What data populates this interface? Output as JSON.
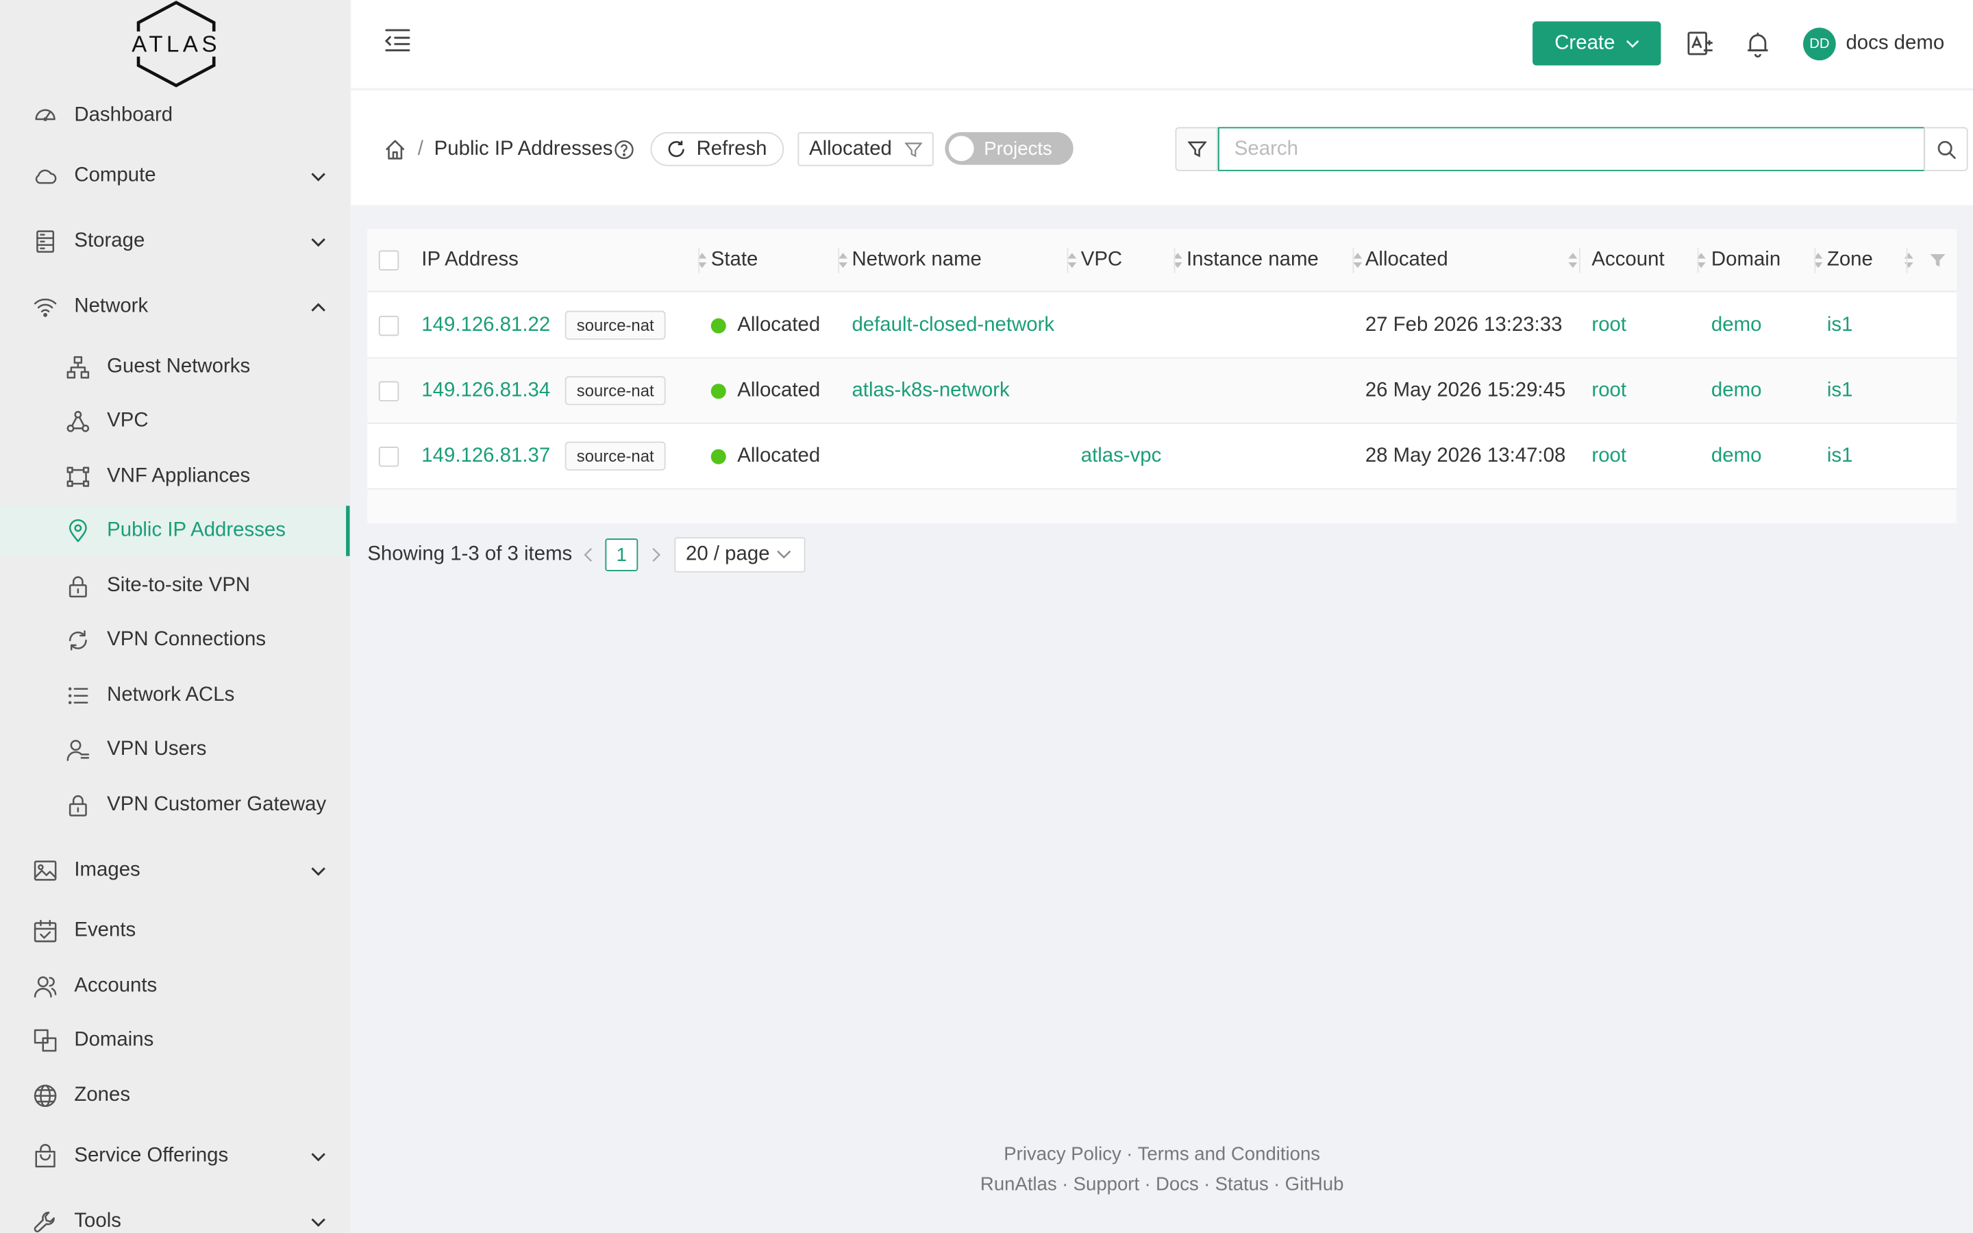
{
  "app": {
    "logo_text": "ATLAS"
  },
  "sidebar": {
    "items": [
      {
        "label": "Dashboard",
        "icon": "dashboard-icon"
      },
      {
        "label": "Compute",
        "icon": "cloud-icon"
      },
      {
        "label": "Storage",
        "icon": "storage-icon"
      },
      {
        "label": "Network",
        "icon": "wifi-icon"
      },
      {
        "label": "Guest Networks",
        "icon": "sitemap-icon"
      },
      {
        "label": "VPC",
        "icon": "vpc-icon"
      },
      {
        "label": "VNF Appliances",
        "icon": "vnf-icon"
      },
      {
        "label": "Public IP Addresses",
        "icon": "location-icon"
      },
      {
        "label": "Site-to-site VPN",
        "icon": "lock-icon"
      },
      {
        "label": "VPN Connections",
        "icon": "sync-icon"
      },
      {
        "label": "Network ACLs",
        "icon": "list-icon"
      },
      {
        "label": "VPN Users",
        "icon": "user-icon"
      },
      {
        "label": "VPN Customer Gateway",
        "icon": "lock-icon"
      },
      {
        "label": "Images",
        "icon": "image-icon"
      },
      {
        "label": "Events",
        "icon": "calendar-icon"
      },
      {
        "label": "Accounts",
        "icon": "team-icon"
      },
      {
        "label": "Domains",
        "icon": "block-icon"
      },
      {
        "label": "Zones",
        "icon": "globe-icon"
      },
      {
        "label": "Service Offerings",
        "icon": "shopping-icon"
      },
      {
        "label": "Tools",
        "icon": "tool-icon"
      }
    ]
  },
  "header": {
    "create_label": "Create",
    "user_initials": "DD",
    "user_name": "docs demo"
  },
  "toolbar": {
    "breadcrumb_title": "Public IP Addresses",
    "breadcrumb_sep": "/",
    "refresh_label": "Refresh",
    "filter_value": "Allocated",
    "projects_toggle_label": "Projects",
    "search_placeholder": "Search"
  },
  "table": {
    "columns": [
      "IP Address",
      "State",
      "Network name",
      "VPC",
      "Instance name",
      "Allocated",
      "Account",
      "Domain",
      "Zone"
    ],
    "rows": [
      {
        "ip": "149.126.81.22",
        "tag": "source-nat",
        "state": "Allocated",
        "network": "default-closed-network",
        "vpc": "",
        "instance": "",
        "allocated": "27 Feb 2026 13:23:33",
        "account": "root",
        "domain": "demo",
        "zone": "is1"
      },
      {
        "ip": "149.126.81.34",
        "tag": "source-nat",
        "state": "Allocated",
        "network": "atlas-k8s-network",
        "vpc": "",
        "instance": "",
        "allocated": "26 May 2026 15:29:45",
        "account": "root",
        "domain": "demo",
        "zone": "is1"
      },
      {
        "ip": "149.126.81.37",
        "tag": "source-nat",
        "state": "Allocated",
        "network": "",
        "vpc": "atlas-vpc",
        "instance": "",
        "allocated": "28 May 2026 13:47:08",
        "account": "root",
        "domain": "demo",
        "zone": "is1"
      }
    ]
  },
  "pagination": {
    "total_text": "Showing 1-3 of 3 items",
    "current_page": "1",
    "page_size": "20 / page"
  },
  "footer": {
    "line1": [
      "Privacy Policy",
      "Terms and Conditions"
    ],
    "line2": [
      "RunAtlas",
      "Support",
      "Docs",
      "Status",
      "GitHub"
    ],
    "separator": "·"
  },
  "colors": {
    "accent": "#1a9e78",
    "status_allocated": "#52c41a"
  }
}
